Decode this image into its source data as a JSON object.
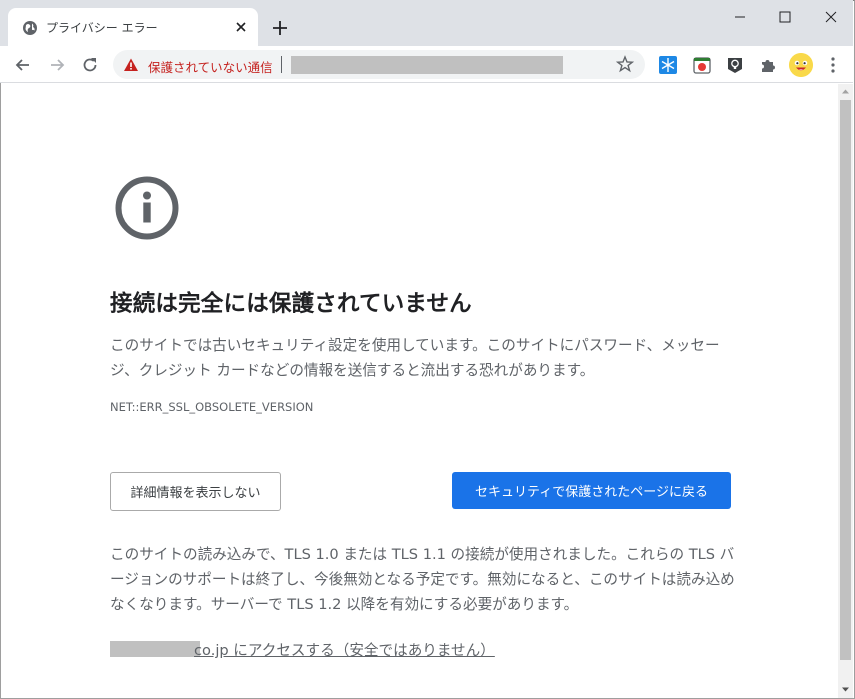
{
  "tab": {
    "title": "プライバシー エラー",
    "favicon": "globe-icon",
    "close_icon": "close-icon"
  },
  "window_controls": [
    "minimize-icon",
    "maximize-icon",
    "close-icon"
  ],
  "toolbar": {
    "back_icon": "back-arrow-icon",
    "forward_icon": "forward-arrow-icon",
    "reload_icon": "reload-icon",
    "security_warning": "保護されていない通信",
    "bookmark_icon": "star-icon",
    "extensions": [
      "snowflake-extension-icon",
      "tomato-extension-icon",
      "bulb-extension-icon",
      "puzzle-icon"
    ],
    "menu_icon": "kebab-menu-icon"
  },
  "content": {
    "icon": "info-icon",
    "heading": "接続は完全には保護されていません",
    "description": "このサイトでは古いセキュリティ設定を使用しています。このサイトにパスワード、メッセージ、クレジット カードなどの情報を送信すると流出する恐れがあります。",
    "error_code": "NET::ERR_SSL_OBSOLETE_VERSION",
    "details_button": "詳細情報を表示しない",
    "back_button": "セキュリティで保護されたページに戻る",
    "details_text": "このサイトの読み込みで、TLS 1.0 または TLS 1.1 の接続が使用されました。これらの TLS バージョンのサポートは終了し、今後無効となる予定です。無効になると、このサイトは読み込めなくなります。サーバーで TLS 1.2 以降を有効にする必要があります。",
    "proceed_link": "co.jp にアクセスする（安全ではありません）"
  },
  "colors": {
    "accent": "#1a73e8",
    "warning": "#c5221f",
    "text_secondary": "#5f6368"
  }
}
